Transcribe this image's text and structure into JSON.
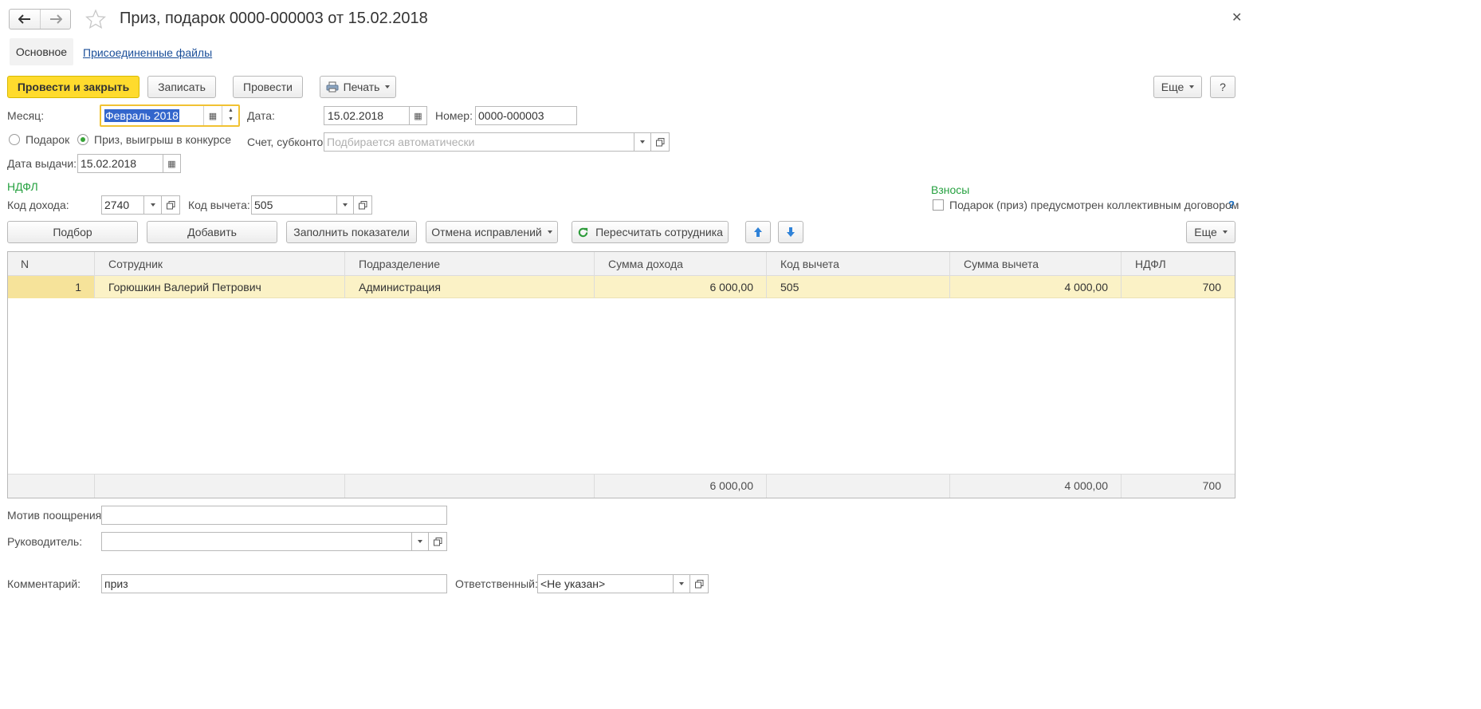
{
  "header": {
    "title": "Приз, подарок 0000-000003 от 15.02.2018"
  },
  "tabs": [
    {
      "label": "Основное"
    },
    {
      "label": "Присоединенные файлы"
    }
  ],
  "toolbar": {
    "post_close": "Провести и закрыть",
    "save": "Записать",
    "post": "Провести",
    "print": "Печать",
    "more": "Еще",
    "help": "?"
  },
  "form": {
    "month_label": "Месяц:",
    "month_value": "Февраль 2018",
    "date_label": "Дата:",
    "date_value": "15.02.2018",
    "number_label": "Номер:",
    "number_value": "0000-000003",
    "radio_gift": "Подарок",
    "radio_prize": "Приз, выигрыш в конкурсе",
    "account_label": "Счет, субконто:",
    "account_placeholder": "Подбирается автоматически",
    "issue_date_label": "Дата выдачи:",
    "issue_date_value": "15.02.2018"
  },
  "ndfl": {
    "section": "НДФЛ",
    "income_code_label": "Код дохода:",
    "income_code_value": "2740",
    "deduction_code_label": "Код вычета:",
    "deduction_code_value": "505"
  },
  "contrib": {
    "section": "Взносы",
    "checkbox_label": "Подарок (приз) предусмотрен коллективным договором",
    "help": "?"
  },
  "table_toolbar": {
    "select": "Подбор",
    "add": "Добавить",
    "fill": "Заполнить показатели",
    "cancel": "Отмена исправлений",
    "recalc": "Пересчитать сотрудника",
    "more": "Еще"
  },
  "table": {
    "columns": [
      "N",
      "Сотрудник",
      "Подразделение",
      "Сумма дохода",
      "Код вычета",
      "Сумма вычета",
      "НДФЛ"
    ],
    "rows": [
      {
        "n": "1",
        "employee": "Горюшкин Валерий Петрович",
        "dept": "Администрация",
        "income": "6 000,00",
        "code": "505",
        "deduction": "4 000,00",
        "ndfl": "700"
      }
    ],
    "totals": {
      "income": "6 000,00",
      "deduction": "4 000,00",
      "ndfl": "700"
    }
  },
  "footer": {
    "motive_label": "Мотив поощрения:",
    "motive_value": "",
    "manager_label": "Руководитель:",
    "manager_value": "",
    "comment_label": "Комментарий:",
    "comment_value": "приз",
    "responsible_label": "Ответственный:",
    "responsible_value": "<Не указан>"
  }
}
